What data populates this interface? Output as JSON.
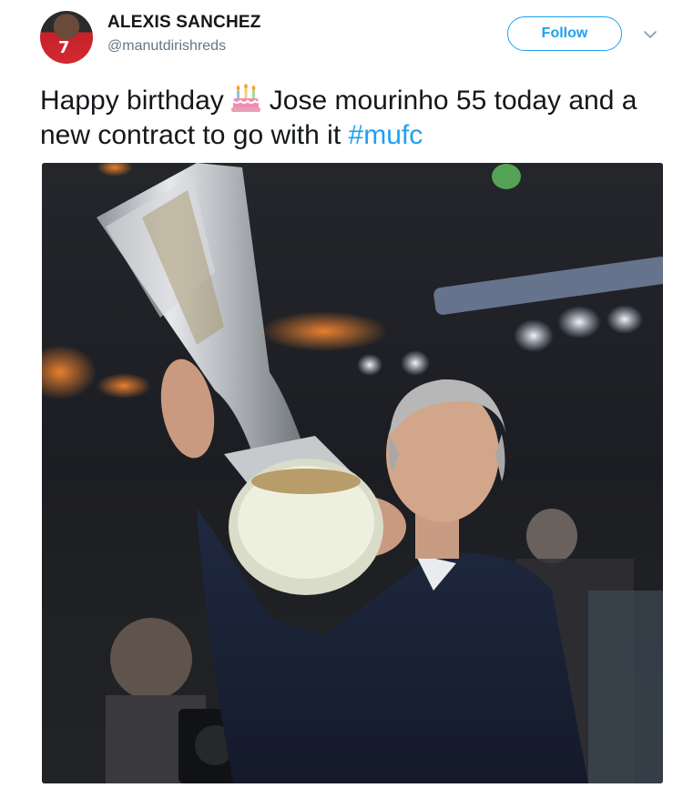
{
  "tweet": {
    "author_name": "ALEXIS SANCHEZ",
    "author_handle": "@manutdirishreds",
    "avatar_number": "7",
    "follow_label": "Follow",
    "text_part1": "Happy birthday",
    "emoji": "birthday-cake",
    "text_part2": "Jose mourinho 55 today and a new contract to go with it",
    "hashtag": "#mufc"
  },
  "colors": {
    "accent": "#1da1f2",
    "text": "#14171a",
    "muted": "#657786"
  },
  "icons": {
    "caret": "chevron-down-icon",
    "emoji": "birthday-cake-icon"
  }
}
